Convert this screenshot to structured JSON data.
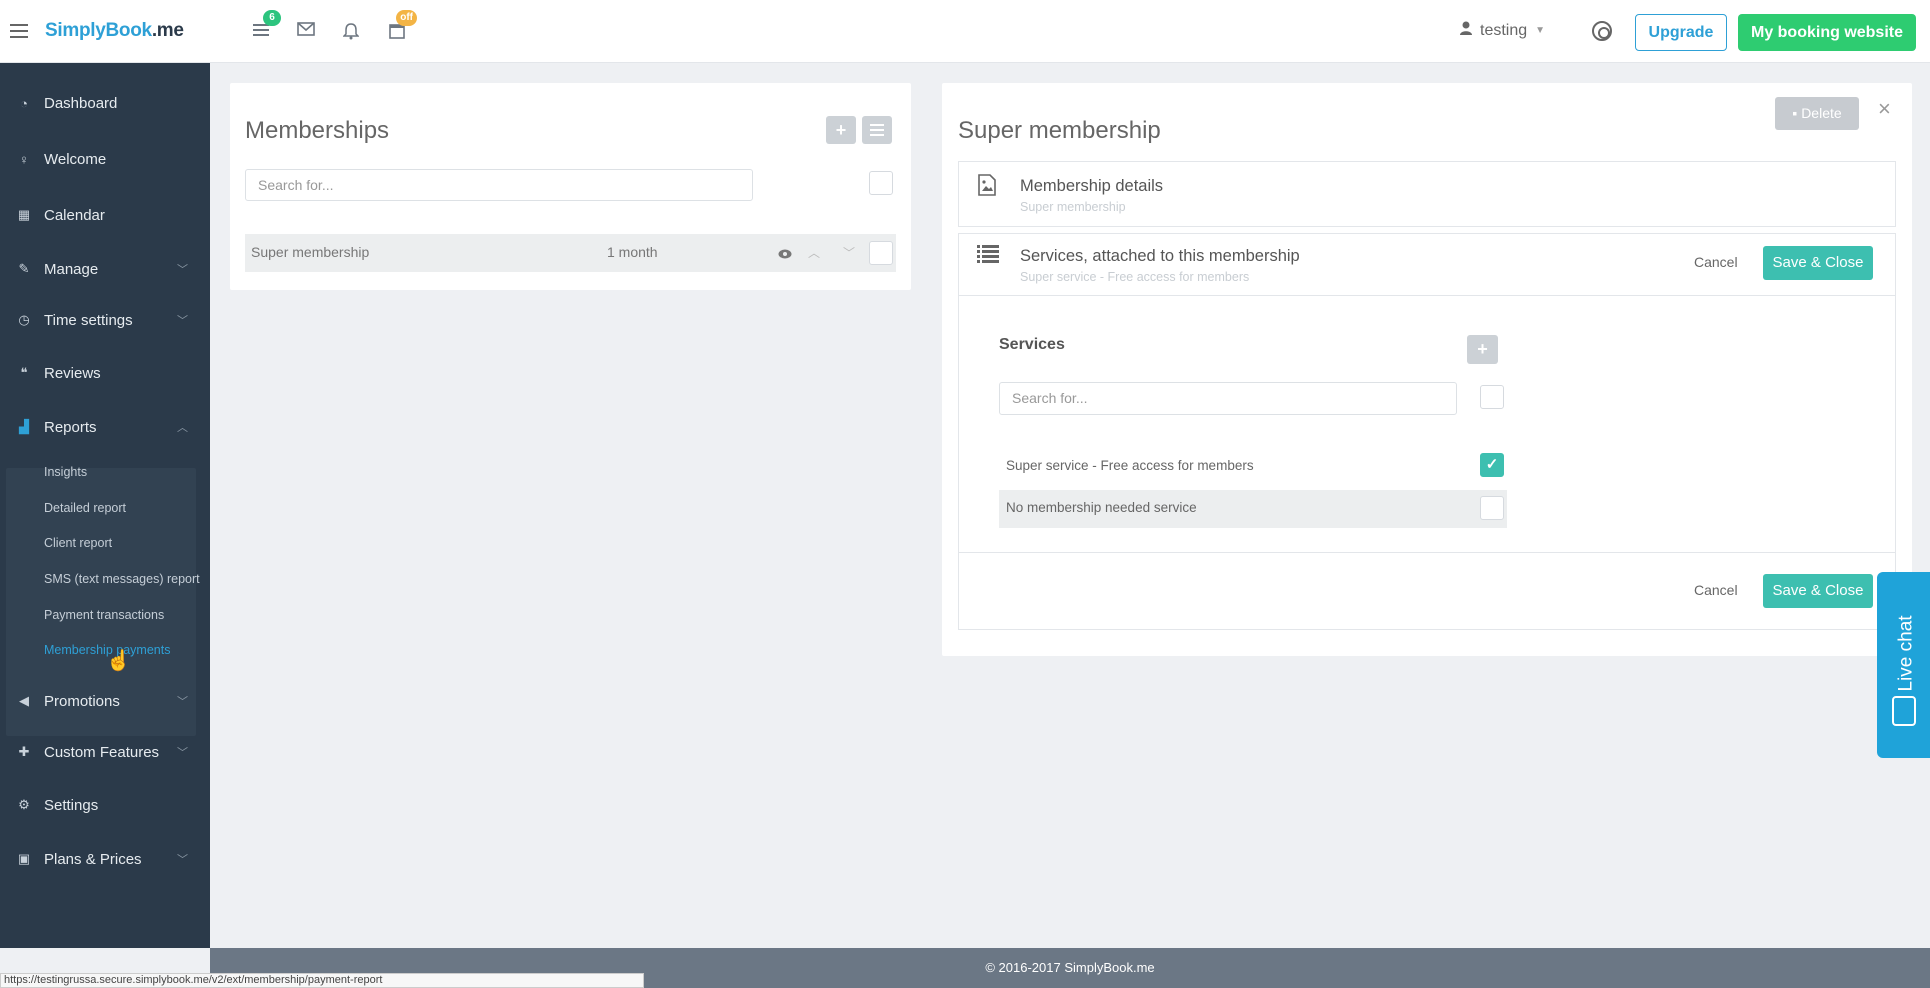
{
  "topbar": {
    "logo_part1": "SimplyBook",
    "logo_part2": ".me",
    "badge_bookings": "6",
    "badge_calendar": "off",
    "username": "testing",
    "upgrade_label": "Upgrade",
    "booking_site_label": "My booking website"
  },
  "sidebar": {
    "items": [
      {
        "label": "Dashboard"
      },
      {
        "label": "Welcome"
      },
      {
        "label": "Calendar"
      },
      {
        "label": "Manage"
      },
      {
        "label": "Time settings"
      },
      {
        "label": "Reviews"
      },
      {
        "label": "Reports"
      },
      {
        "label": "Promotions"
      },
      {
        "label": "Custom Features"
      },
      {
        "label": "Settings"
      },
      {
        "label": "Plans & Prices"
      }
    ],
    "reports_sub": [
      {
        "label": "Insights"
      },
      {
        "label": "Detailed report"
      },
      {
        "label": "Client report"
      },
      {
        "label": "SMS (text messages) report"
      },
      {
        "label": "Payment transactions"
      },
      {
        "label": "Membership payments"
      }
    ]
  },
  "memberships": {
    "title": "Memberships",
    "search_placeholder": "Search for...",
    "rows": [
      {
        "name": "Super membership",
        "duration": "1 month"
      }
    ]
  },
  "detail": {
    "title": "Super membership",
    "delete_label": "Delete",
    "close_label": "×",
    "details_section": {
      "title": "Membership details",
      "subtitle": "Super membership"
    },
    "services_section": {
      "title": "Services, attached to this membership",
      "subtitle": "Super service - Free access for members",
      "cancel_label": "Cancel",
      "save_label": "Save & Close",
      "services_heading": "Services",
      "search_placeholder": "Search for...",
      "services": [
        {
          "name": "Super service - Free access for members",
          "checked": true
        },
        {
          "name": "No membership needed service",
          "checked": false
        }
      ],
      "bottom_cancel_label": "Cancel",
      "bottom_save_label": "Save & Close"
    }
  },
  "footer": {
    "copyright": "© 2016-2017 SimplyBook.me",
    "status_url": "https://testingrussa.secure.simplybook.me/v2/ext/membership/payment-report"
  },
  "livechat": {
    "label": "Live chat"
  },
  "colors": {
    "sidebar_bg": "#2b3a4a",
    "accent_blue": "#2ea0d6",
    "accent_green": "#2ecc71",
    "teal": "#3dbfb0"
  }
}
